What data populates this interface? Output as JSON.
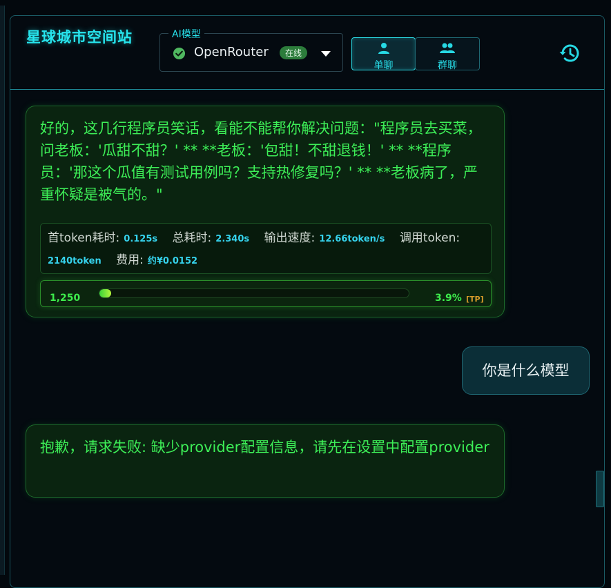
{
  "header": {
    "app_title": "星球城市空间站",
    "model_select": {
      "legend": "AI模型",
      "value": "OpenRouter",
      "status_badge": "在线",
      "status_icon": "check-circle-icon"
    },
    "mode_tabs": [
      {
        "label": "单聊",
        "icon": "person-icon",
        "active": true
      },
      {
        "label": "群聊",
        "icon": "group-icon",
        "active": false
      }
    ],
    "history_icon": "history-icon"
  },
  "messages": [
    {
      "role": "assistant",
      "text": "好的，这几行程序员笑话，看能不能帮你解决问题：\"程序员去买菜，问老板：'瓜甜不甜？' ** **老板：'包甜！不甜退钱！' ** **程序员：'那这个瓜值有测试用例吗？支持热修复吗？' ** **老板病了，严重怀疑是被气的。\"",
      "stats": {
        "first_token_label": "首token耗时:",
        "first_token_value": "0.125s",
        "total_label": "总耗时:",
        "total_value": "2.340s",
        "speed_label": "输出速度:",
        "speed_value": "12.66token/s",
        "tokens_label": "调用token:",
        "tokens_value": "2140token",
        "cost_label": "费用:",
        "cost_value": "约¥0.0152"
      },
      "progress": {
        "count": "1,250",
        "percent_text": "3.9%",
        "percent_value": 3.9,
        "tag": "[TP]"
      }
    },
    {
      "role": "user",
      "text": "你是什么模型"
    },
    {
      "role": "assistant",
      "text": "抱歉，请求失败: 缺少provider配置信息，请先在设置中配置provider"
    }
  ],
  "colors": {
    "accent": "#27e6ee",
    "ai_text": "#3dee57",
    "background": "#03080d"
  }
}
